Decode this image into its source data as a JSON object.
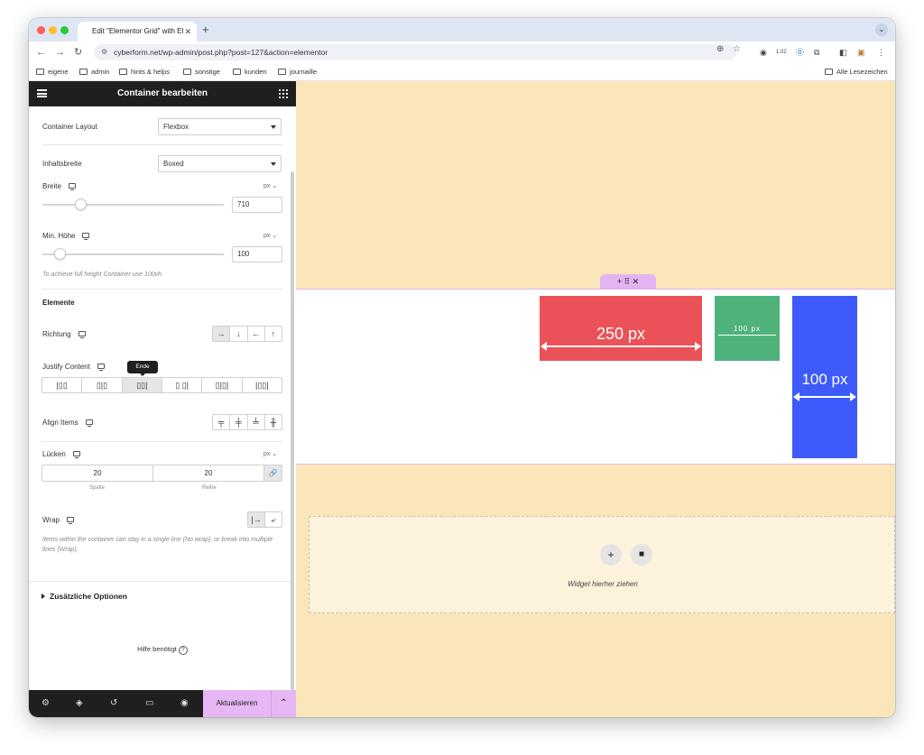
{
  "browser": {
    "tab_title": "Edit \"Elementor Grid\" with El",
    "tab_close": "✕",
    "new_tab": "+",
    "url": "cyberform.net/wp-admin/post.php?post=127&action=elementor",
    "zoom_badge": "1.02",
    "bookmarks": [
      "eigene",
      "admin",
      "hints & helps",
      "sonstige",
      "kunden",
      "journaille"
    ],
    "all_bookmarks": "Alle Lesezeichen"
  },
  "panel": {
    "title": "Container bearbeiten",
    "container_layout": {
      "label": "Container Layout",
      "value": "Flexbox"
    },
    "content_width": {
      "label": "Inhaltsbreite",
      "value": "Boxed"
    },
    "width": {
      "label": "Breite",
      "unit": "px ⌄",
      "value": "710",
      "slider_fraction": 0.19
    },
    "min_height": {
      "label": "Min. Höhe",
      "unit": "px ⌄",
      "value": "100",
      "slider_fraction": 0.07
    },
    "min_height_hint": "To achieve full height Container use 100vh.",
    "elements_heading": "Elemente",
    "direction": {
      "label": "Richtung",
      "options": [
        "→",
        "↓",
        "←",
        "↑"
      ],
      "active": 0
    },
    "justify": {
      "label": "Justify Content",
      "tooltip": "Ende",
      "options": [
        "|▯▯",
        "▯|▯",
        "▯▯|",
        "▯ ▯|",
        "▯|▯|",
        "|▯▯|"
      ],
      "active": 2
    },
    "align": {
      "label": "Align Items",
      "options": [
        "╤",
        "╪",
        "╧",
        "╫"
      ]
    },
    "gaps": {
      "label": "Lücken",
      "unit": "px ⌄",
      "column": "20",
      "row": "20",
      "column_label": "Spalte",
      "row_label": "Reihe",
      "link_icon": "🔗"
    },
    "wrap": {
      "label": "Wrap",
      "options": [
        "|→",
        "⤶"
      ],
      "hint": "Items within the container can stay in a single line (No wrap), or break into multiple lines (Wrap)."
    },
    "additional": "Zusätzliche Optionen",
    "help": "Hilfe benötigt",
    "help_icon": "?",
    "update_button": "Aktualisieren",
    "update_arrow": "⌃"
  },
  "canvas": {
    "handle_icons": "+   ⠿   ✕",
    "box_red_label": "250 px",
    "box_green_label": "100 px",
    "box_blue_label": "100 px",
    "dropzone_text": "Widget hierher ziehen",
    "collapse_icon": "‹",
    "background_color": "#fbe6ba",
    "red": "#eb5257",
    "green": "#4fb27b",
    "blue": "#3c5bfa"
  }
}
